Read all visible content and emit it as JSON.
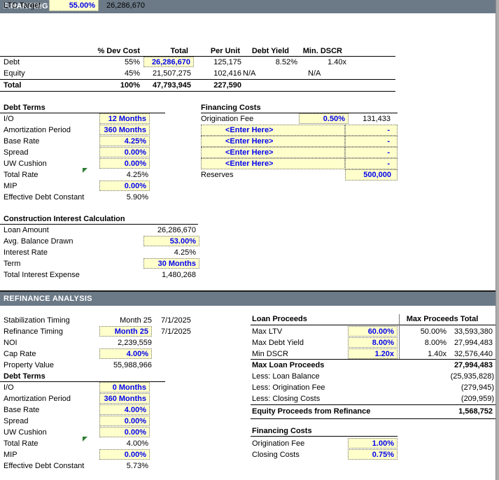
{
  "colors": {
    "header_bar": "#6C7A88",
    "input_bg": "#FFFFCC",
    "input_text": "#0000EE",
    "flag_green": "#2E7D32"
  },
  "financing": {
    "bar_title": "FINANCING",
    "ltc_target": {
      "label": "LTC Target",
      "value": "55.00%",
      "amount": "26,286,670"
    },
    "sources_table": {
      "headers": {
        "dev_cost": "% Dev Cost",
        "total": "Total",
        "per_unit": "Per Unit",
        "debt_yield": "Debt Yield",
        "min_dscr": "Min. DSCR"
      },
      "rows": [
        {
          "label": "Debt",
          "dev_cost": "55%",
          "total": "26,286,670",
          "per_unit": "125,175",
          "debt_yield": "8.52%",
          "min_dscr": "1.40x"
        },
        {
          "label": "Equity",
          "dev_cost": "45%",
          "total": "21,507,275",
          "per_unit": "102,416",
          "debt_yield": "N/A",
          "min_dscr": "N/A"
        }
      ],
      "total_row": {
        "label": "Total",
        "dev_cost": "100%",
        "total": "47,793,945",
        "per_unit": "227,590"
      }
    },
    "debt_terms": {
      "title": "Debt Terms",
      "rows": [
        {
          "label": "I/O",
          "value": "12 Months"
        },
        {
          "label": "Amortization Period",
          "value": "360 Months"
        },
        {
          "label": "Base Rate",
          "value": "4.25%"
        },
        {
          "label": "Spread",
          "value": "0.00%"
        },
        {
          "label": "UW Cushion",
          "value": "0.00%"
        },
        {
          "label": "Total Rate",
          "value": "4.25%"
        },
        {
          "label": "MIP",
          "value": "0.00%"
        },
        {
          "label": "Effective Debt Constant",
          "value": "5.90%"
        }
      ]
    },
    "financing_costs": {
      "title": "Financing Costs",
      "origination": {
        "label": "Origination Fee",
        "rate": "0.50%",
        "amount": "131,433"
      },
      "enter_rows": [
        {
          "label": "<Enter Here>",
          "amount": "-"
        },
        {
          "label": "<Enter Here>",
          "amount": "-"
        },
        {
          "label": "<Enter Here>",
          "amount": "-"
        },
        {
          "label": "<Enter Here>",
          "amount": "-"
        }
      ],
      "reserves": {
        "label": "Reserves",
        "amount": "500,000"
      }
    },
    "construction_interest": {
      "title": "Construction Interest Calculation",
      "rows": [
        {
          "label": "Loan Amount",
          "value": "26,286,670"
        },
        {
          "label": "Avg. Balance Drawn",
          "value": "53.00%"
        },
        {
          "label": "Interest Rate",
          "value": "4.25%"
        },
        {
          "label": "Term",
          "value": "30 Months"
        },
        {
          "label": "Total Interest Expense",
          "value": "1,480,268"
        }
      ]
    }
  },
  "refinance": {
    "bar_title": "REFINANCE ANALYSIS",
    "assumptions": [
      {
        "label": "Stabilization Timing",
        "value": "Month 25",
        "date": "7/1/2025"
      },
      {
        "label": "Refinance Timing",
        "value": "Month 25",
        "date": "7/1/2025"
      },
      {
        "label": "NOI",
        "value": "2,239,559",
        "date": ""
      },
      {
        "label": "Cap Rate",
        "value": "4.00%",
        "date": ""
      },
      {
        "label": "Property Value",
        "value": "55,988,966",
        "date": ""
      }
    ],
    "debt_terms": {
      "title": "Debt Terms",
      "rows": [
        {
          "label": "I/O",
          "value": "0 Months"
        },
        {
          "label": "Amortization Period",
          "value": "360 Months"
        },
        {
          "label": "Base Rate",
          "value": "4.00%"
        },
        {
          "label": "Spread",
          "value": "0.00%"
        },
        {
          "label": "UW Cushion",
          "value": "0.00%"
        },
        {
          "label": "Total Rate",
          "value": "4.00%"
        },
        {
          "label": "MIP",
          "value": "0.00%"
        },
        {
          "label": "Effective Debt Constant",
          "value": "5.73%"
        }
      ]
    },
    "loan_proceeds": {
      "title": "Loan Proceeds",
      "proceeds_header": "Max Proceeds Total",
      "rows": [
        {
          "label": "Max LTV",
          "input": "60.00%",
          "max_proceeds": "50.00%",
          "total": "33,593,380"
        },
        {
          "label": "Max Debt Yield",
          "input": "8.00%",
          "max_proceeds": "8.00%",
          "total": "27,994,483"
        },
        {
          "label": "Min DSCR",
          "input": "1.20x",
          "max_proceeds": "1.40x",
          "total": "32,576,440"
        }
      ],
      "max_loan_proceeds": {
        "label": "Max Loan Proceeds",
        "value": "27,994,483"
      },
      "deductions": [
        {
          "label": "Less: Loan Balance",
          "value": "(25,935,828)"
        },
        {
          "label": "Less: Origination Fee",
          "value": "(279,945)"
        },
        {
          "label": "Less: Closing Costs",
          "value": "(209,959)"
        }
      ],
      "equity_proceeds": {
        "label": "Equity Proceeds from Refinance",
        "value": "1,568,752"
      }
    },
    "financing_costs": {
      "title": "Financing Costs",
      "rows": [
        {
          "label": "Origination Fee",
          "value": "1.00%"
        },
        {
          "label": "Closing Costs",
          "value": "0.75%"
        }
      ]
    }
  }
}
